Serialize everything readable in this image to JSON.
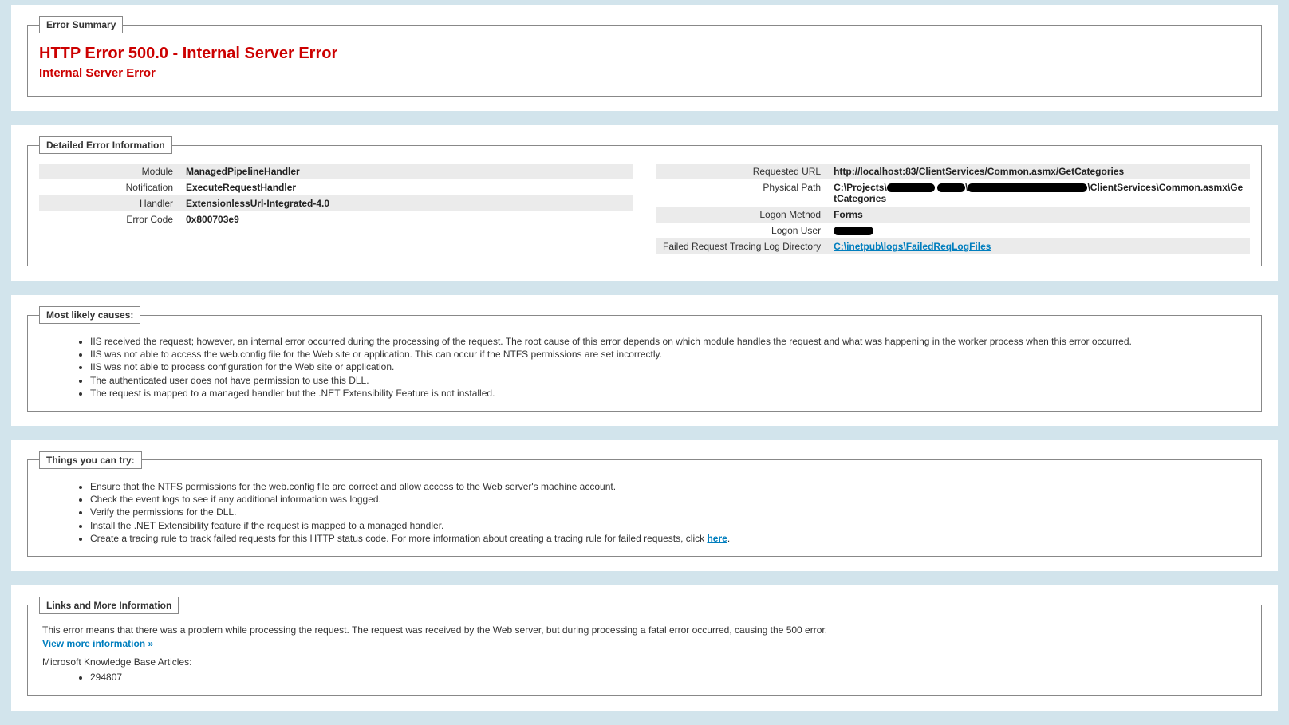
{
  "summary": {
    "legend": "Error Summary",
    "title": "HTTP Error 500.0 - Internal Server Error",
    "subtitle": "Internal Server Error"
  },
  "details": {
    "legend": "Detailed Error Information",
    "left": {
      "module_label": "Module",
      "module": "ManagedPipelineHandler",
      "notification_label": "Notification",
      "notification": "ExecuteRequestHandler",
      "handler_label": "Handler",
      "handler": "ExtensionlessUrl-Integrated-4.0",
      "errorcode_label": "Error Code",
      "errorcode": "0x800703e9"
    },
    "right": {
      "requrl_label": "Requested URL",
      "requrl": "http://localhost:83/ClientServices/Common.asmx/GetCategories",
      "physpath_label": "Physical Path",
      "physpath_prefix": "C:\\Projects\\",
      "physpath_suffix": "\\ClientServices\\Common.asmx\\GetCategories",
      "logonmethod_label": "Logon Method",
      "logonmethod": "Forms",
      "logonuser_label": "Logon User",
      "logonuser_redacted": true,
      "frt_label": "Failed Request Tracing Log Directory",
      "frt_link": "C:\\inetpub\\logs\\FailedReqLogFiles"
    }
  },
  "causes": {
    "legend": "Most likely causes:",
    "items": [
      "IIS received the request; however, an internal error occurred during the processing of the request. The root cause of this error depends on which module handles the request and what was happening in the worker process when this error occurred.",
      "IIS was not able to access the web.config file for the Web site or application. This can occur if the NTFS permissions are set incorrectly.",
      "IIS was not able to process configuration for the Web site or application.",
      "The authenticated user does not have permission to use this DLL.",
      "The request is mapped to a managed handler but the .NET Extensibility Feature is not installed."
    ]
  },
  "try": {
    "legend": "Things you can try:",
    "items": [
      "Ensure that the NTFS permissions for the web.config file are correct and allow access to the Web server's machine account.",
      "Check the event logs to see if any additional information was logged.",
      "Verify the permissions for the DLL.",
      "Install the .NET Extensibility feature if the request is mapped to a managed handler."
    ],
    "tracing_prefix": "Create a tracing rule to track failed requests for this HTTP status code. For more information about creating a tracing rule for failed requests, click ",
    "tracing_link": "here",
    "tracing_suffix": "."
  },
  "moreinfo": {
    "legend": "Links and More Information",
    "text": "This error means that there was a problem while processing the request. The request was received by the Web server, but during processing a fatal error occurred, causing the 500 error.",
    "view_more": "View more information »",
    "kb_label": "Microsoft Knowledge Base Articles:",
    "kb_items": [
      "294807"
    ]
  }
}
